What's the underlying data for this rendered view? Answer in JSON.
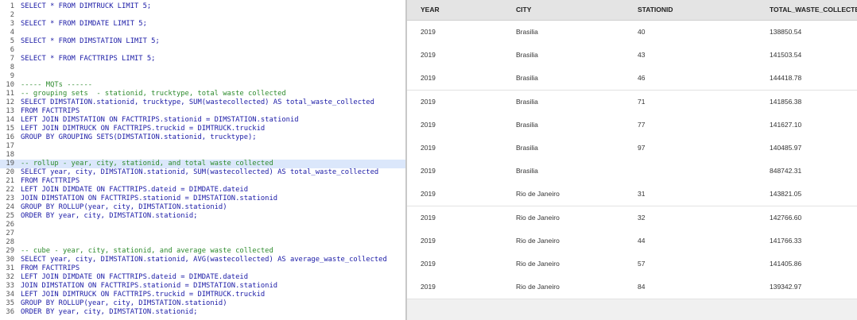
{
  "editor": {
    "lines": [
      {
        "n": "1",
        "text": "SELECT * FROM DIMTRUCK LIMIT 5;",
        "kind": "code"
      },
      {
        "n": "2",
        "text": "",
        "kind": "code"
      },
      {
        "n": "3",
        "text": "SELECT * FROM DIMDATE LIMIT 5;",
        "kind": "code"
      },
      {
        "n": "4",
        "text": "",
        "kind": "code"
      },
      {
        "n": "5",
        "text": "SELECT * FROM DIMSTATION LIMIT 5;",
        "kind": "code"
      },
      {
        "n": "6",
        "text": "",
        "kind": "code"
      },
      {
        "n": "7",
        "text": "SELECT * FROM FACTTRIPS LIMIT 5;",
        "kind": "code"
      },
      {
        "n": "8",
        "text": "",
        "kind": "code"
      },
      {
        "n": "9",
        "text": "",
        "kind": "code"
      },
      {
        "n": "10",
        "text": "----- MQTs ------",
        "kind": "comment"
      },
      {
        "n": "11",
        "text": "-- grouping sets  - stationid, trucktype, total waste collected",
        "kind": "comment"
      },
      {
        "n": "12",
        "text": "SELECT DIMSTATION.stationid, trucktype, SUM(wastecollected) AS total_waste_collected",
        "kind": "code"
      },
      {
        "n": "13",
        "text": "FROM FACTTRIPS",
        "kind": "code"
      },
      {
        "n": "14",
        "text": "LEFT JOIN DIMSTATION ON FACTTRIPS.stationid = DIMSTATION.stationid",
        "kind": "code"
      },
      {
        "n": "15",
        "text": "LEFT JOIN DIMTRUCK ON FACTTRIPS.truckid = DIMTRUCK.truckid",
        "kind": "code"
      },
      {
        "n": "16",
        "text": "GROUP BY GROUPING SETS(DIMSTATION.stationid, trucktype);",
        "kind": "code"
      },
      {
        "n": "17",
        "text": "",
        "kind": "code"
      },
      {
        "n": "18",
        "text": "",
        "kind": "code"
      },
      {
        "n": "19",
        "text": "-- rollup - year, city, stationid, and total waste collected",
        "kind": "comment",
        "highlight": true
      },
      {
        "n": "20",
        "text": "SELECT year, city, DIMSTATION.stationid, SUM(wastecollected) AS total_waste_collected",
        "kind": "code"
      },
      {
        "n": "21",
        "text": "FROM FACTTRIPS",
        "kind": "code"
      },
      {
        "n": "22",
        "text": "LEFT JOIN DIMDATE ON FACTTRIPS.dateid = DIMDATE.dateid",
        "kind": "code"
      },
      {
        "n": "23",
        "text": "JOIN DIMSTATION ON FACTTRIPS.stationid = DIMSTATION.stationid",
        "kind": "code"
      },
      {
        "n": "24",
        "text": "GROUP BY ROLLUP(year, city, DIMSTATION.stationid)",
        "kind": "code"
      },
      {
        "n": "25",
        "text": "ORDER BY year, city, DIMSTATION.stationid;",
        "kind": "code"
      },
      {
        "n": "26",
        "text": "",
        "kind": "code"
      },
      {
        "n": "27",
        "text": "",
        "kind": "code"
      },
      {
        "n": "28",
        "text": "",
        "kind": "code"
      },
      {
        "n": "29",
        "text": "-- cube - year, city, stationid, and average waste collected",
        "kind": "comment"
      },
      {
        "n": "30",
        "text": "SELECT year, city, DIMSTATION.stationid, AVG(wastecollected) AS average_waste_collected",
        "kind": "code"
      },
      {
        "n": "31",
        "text": "FROM FACTTRIPS",
        "kind": "code"
      },
      {
        "n": "32",
        "text": "LEFT JOIN DIMDATE ON FACTTRIPS.dateid = DIMDATE.dateid",
        "kind": "code"
      },
      {
        "n": "33",
        "text": "JOIN DIMSTATION ON FACTTRIPS.stationid = DIMSTATION.stationid",
        "kind": "code"
      },
      {
        "n": "34",
        "text": "LEFT JOIN DIMTRUCK ON FACTTRIPS.truckid = DIMTRUCK.truckid",
        "kind": "code"
      },
      {
        "n": "35",
        "text": "GROUP BY ROLLUP(year, city, DIMSTATION.stationid)",
        "kind": "code"
      },
      {
        "n": "36",
        "text": "ORDER BY year, city, DIMSTATION.stationid;",
        "kind": "code"
      }
    ]
  },
  "results": {
    "columns": [
      "YEAR",
      "CITY",
      "STATIONID",
      "TOTAL_WASTE_COLLECTED"
    ],
    "rows": [
      [
        "2019",
        "Brasilia",
        "40",
        "138850.54"
      ],
      [
        "2019",
        "Brasilia",
        "43",
        "141503.54"
      ],
      [
        "2019",
        "Brasilia",
        "46",
        "144418.78"
      ],
      [
        "2019",
        "Brasilia",
        "71",
        "141856.38"
      ],
      [
        "2019",
        "Brasilia",
        "77",
        "141627.10"
      ],
      [
        "2019",
        "Brasilia",
        "97",
        "140485.97"
      ],
      [
        "2019",
        "Brasilia",
        "",
        "848742.31"
      ],
      [
        "2019",
        "Rio de Janeiro",
        "31",
        "143821.05"
      ],
      [
        "2019",
        "Rio de Janeiro",
        "32",
        "142766.60"
      ],
      [
        "2019",
        "Rio de Janeiro",
        "44",
        "141766.33"
      ],
      [
        "2019",
        "Rio de Janeiro",
        "57",
        "141405.86"
      ],
      [
        "2019",
        "Rio de Janeiro",
        "84",
        "139342.97"
      ]
    ]
  },
  "colors": {
    "keyword": "#1a1aa6",
    "comment": "#2e8b2e",
    "highlight_line": "#dbe7fb",
    "header_bg": "#e4e4e4"
  }
}
